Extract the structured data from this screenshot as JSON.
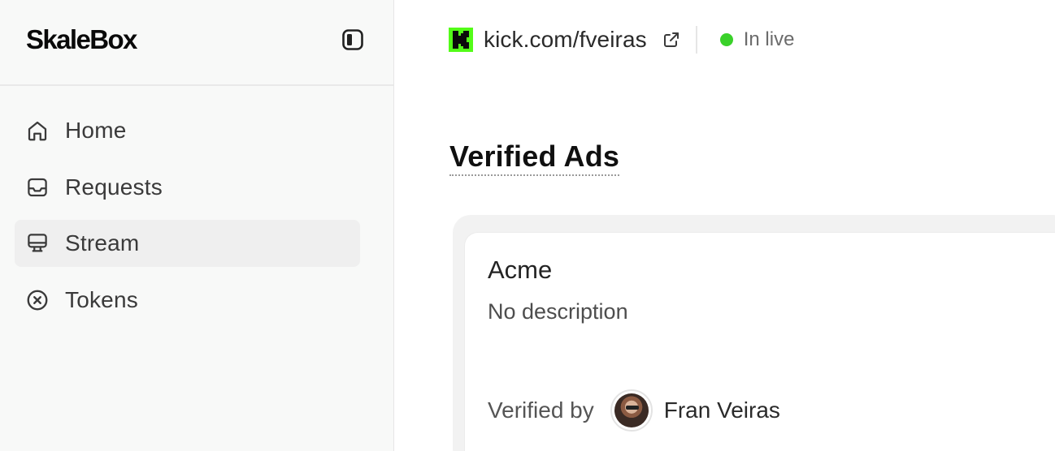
{
  "sidebar": {
    "brand": "SkaleBox",
    "collapse_icon": "sidebar-toggle-icon",
    "items": [
      {
        "label": "Home",
        "icon": "home-icon",
        "active": false
      },
      {
        "label": "Requests",
        "icon": "inbox-icon",
        "active": false
      },
      {
        "label": "Stream",
        "icon": "monitor-icon",
        "active": true
      },
      {
        "label": "Tokens",
        "icon": "x-circle-icon",
        "active": false
      }
    ]
  },
  "header": {
    "channel_url": "kick.com/fveiras",
    "platform_icon": "kick-logo-icon",
    "external_icon": "external-link-icon",
    "status_text": "In live",
    "status_color": "#3ad12a",
    "kick_color": "#53fc18"
  },
  "main": {
    "section_title": "Verified Ads",
    "ad": {
      "name": "Acme",
      "description": "No description",
      "verified_by_label": "Verified by",
      "verifier_name": "Fran Veiras"
    }
  }
}
